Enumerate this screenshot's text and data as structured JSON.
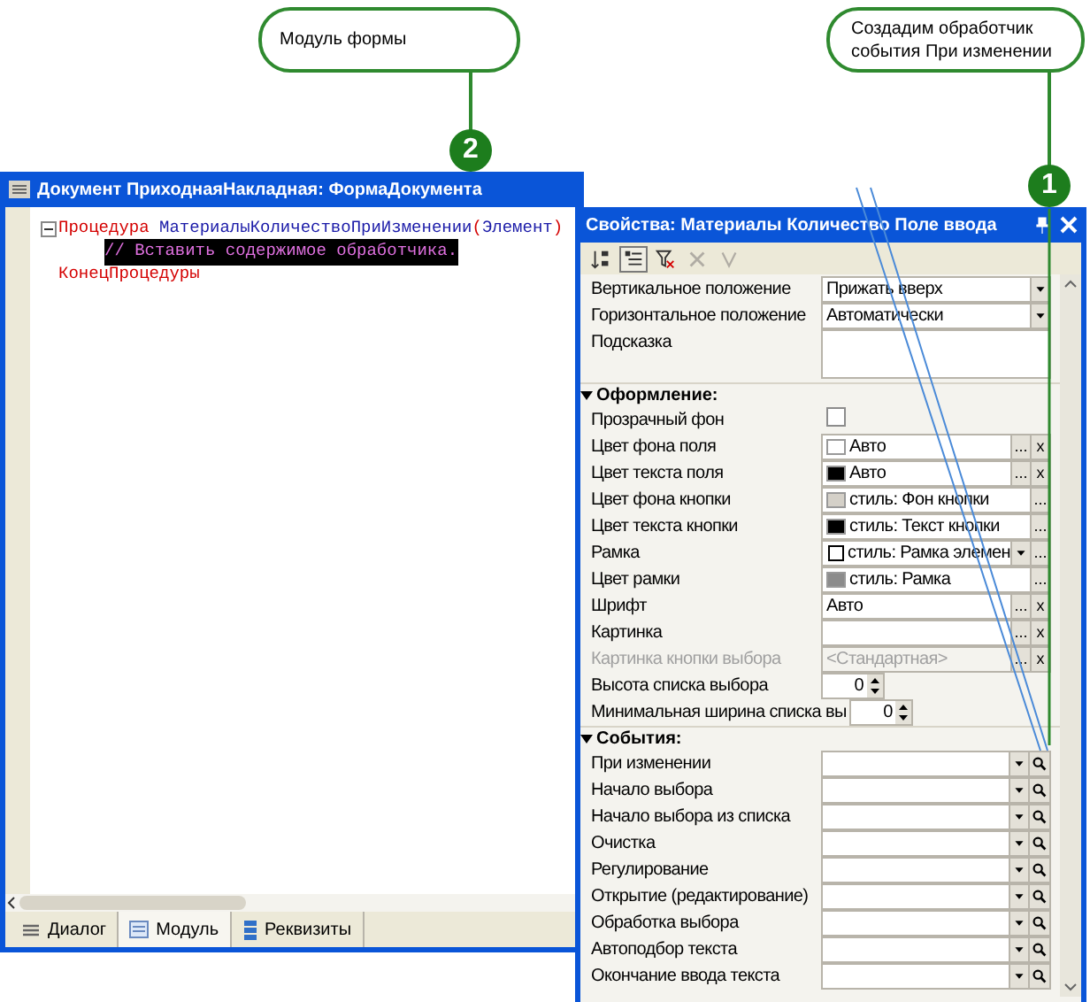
{
  "callouts": [
    {
      "text": "Модуль формы",
      "badge": "2"
    },
    {
      "text": "Создадим обработчик события При изменении",
      "badge": "1"
    }
  ],
  "editor": {
    "title": "Документ ПриходнаяНакладная: ФормаДокумента",
    "code": [
      {
        "expander": true,
        "selected": false,
        "tokens": [
          {
            "kind": "keyword",
            "text": "Процедура"
          },
          {
            "kind": "name",
            "text": " МатериалыКоличествоПриИзменении"
          },
          {
            "kind": "punct",
            "text": "("
          },
          {
            "kind": "name",
            "text": "Элемент"
          },
          {
            "kind": "punct",
            "text": ")"
          }
        ]
      },
      {
        "expander": false,
        "selected": true,
        "tokens": [
          {
            "kind": "comment",
            "text": "// Вставить содержимое обработчика."
          }
        ]
      },
      {
        "expander": false,
        "selected": false,
        "tokens": [
          {
            "kind": "keyword",
            "text": "КонецПроцедуры"
          }
        ]
      }
    ],
    "tabs": [
      {
        "label": "Диалог",
        "selected": false,
        "kind": "dialog"
      },
      {
        "label": "Модуль",
        "selected": true,
        "kind": "module"
      },
      {
        "label": "Реквизиты",
        "selected": false,
        "kind": "attributes"
      }
    ]
  },
  "properties": {
    "title": "Свойства: Материалы Количество Поле ввода",
    "toolbar": [
      {
        "kind": "sort",
        "pressed": false,
        "disabled": false
      },
      {
        "kind": "categories",
        "pressed": true,
        "disabled": false
      },
      {
        "kind": "filter",
        "pressed": false,
        "disabled": false
      },
      {
        "kind": "cancel",
        "pressed": false,
        "disabled": true
      },
      {
        "kind": "apply",
        "pressed": false,
        "disabled": true
      }
    ],
    "groups": [
      {
        "rows": [
          {
            "label": "Вертикальное положение",
            "kind": "select",
            "value": "Прижать вверх",
            "disabled": false
          },
          {
            "label": "Горизонтальное положение",
            "kind": "select",
            "value": "Автоматически",
            "disabled": false
          },
          {
            "label": "Подсказка",
            "kind": "memo",
            "disabled": false
          }
        ]
      },
      {
        "heading": "Оформление:",
        "expanded": true,
        "rows": [
          {
            "label": "Прозрачный фон",
            "kind": "checkbox",
            "checked": false,
            "disabled": false
          },
          {
            "label": "Цвет фона поля",
            "kind": "color",
            "color": "#ffffff",
            "value": "Авто",
            "buttons": [
              "...",
              "x"
            ],
            "disabled": false
          },
          {
            "label": "Цвет текста поля",
            "kind": "color",
            "color": "#000000",
            "value": "Авто",
            "buttons": [
              "...",
              "x"
            ],
            "disabled": false
          },
          {
            "label": "Цвет фона кнопки",
            "kind": "color",
            "color": "#d4d0c8",
            "value": "стиль: Фон кнопки",
            "buttons": [
              "..."
            ],
            "disabled": false
          },
          {
            "label": "Цвет текста кнопки",
            "kind": "color",
            "color": "#000000",
            "value": "стиль: Текст кнопки",
            "buttons": [
              "..."
            ],
            "disabled": false
          },
          {
            "label": "Рамка",
            "kind": "border",
            "value": "стиль: Рамка элемен",
            "buttons": [
              "..."
            ],
            "disabled": false
          },
          {
            "label": "Цвет рамки",
            "kind": "color",
            "color": "#8c8c8c",
            "value": "стиль: Рамка",
            "buttons": [
              "..."
            ],
            "disabled": false
          },
          {
            "label": "Шрифт",
            "kind": "text",
            "value": "Авто",
            "buttons": [
              "...",
              "x"
            ],
            "disabled": false
          },
          {
            "label": "Картинка",
            "kind": "text",
            "buttons": [
              "...",
              "x"
            ],
            "disabled": false
          },
          {
            "label": "Картинка кнопки выбора",
            "kind": "text",
            "value": "<Стандартная>",
            "buttons": [
              "...",
              "x"
            ],
            "disabled": true
          },
          {
            "label": "Высота списка выбора",
            "kind": "spin",
            "value": "0",
            "disabled": false
          },
          {
            "label": "Минимальная ширина списка вы",
            "kind": "spin",
            "value": "0",
            "disabled": false
          }
        ]
      },
      {
        "heading": "События:",
        "expanded": true,
        "rows": [
          {
            "label": "При изменении",
            "kind": "event",
            "disabled": false
          },
          {
            "label": "Начало выбора",
            "kind": "event",
            "disabled": false
          },
          {
            "label": "Начало выбора из списка",
            "kind": "event",
            "disabled": false
          },
          {
            "label": "Очистка",
            "kind": "event",
            "disabled": false
          },
          {
            "label": "Регулирование",
            "kind": "event",
            "disabled": false
          },
          {
            "label": "Открытие (редактирование)",
            "kind": "event",
            "disabled": false
          },
          {
            "label": "Обработка выбора",
            "kind": "event",
            "disabled": false
          },
          {
            "label": "Автоподбор текста",
            "kind": "event",
            "disabled": false
          },
          {
            "label": "Окончание ввода текста",
            "kind": "event",
            "disabled": false
          }
        ]
      }
    ]
  }
}
